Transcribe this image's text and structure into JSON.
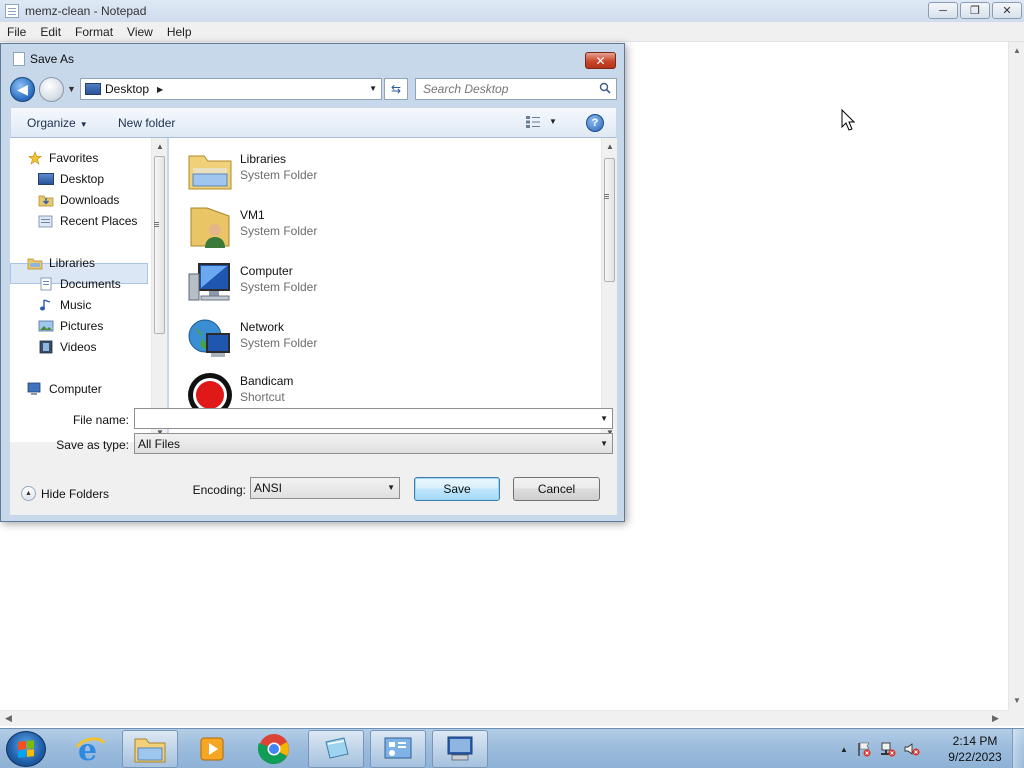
{
  "notepad": {
    "title": "memz-clean - Notepad",
    "menu": [
      "File",
      "Edit",
      "Format",
      "View",
      "Help"
    ],
    "window_buttons": {
      "minimize": "─",
      "restore": "❐",
      "close": "✕"
    }
  },
  "dialog": {
    "title": "Save As",
    "close_label": "✕",
    "address": {
      "location": "Desktop"
    },
    "search": {
      "placeholder": "Search Desktop"
    },
    "toolbar": {
      "organize": "Organize",
      "new_folder": "New folder",
      "help": "?"
    },
    "nav_pane": {
      "favorites_header": "Favorites",
      "favorites": [
        "Desktop",
        "Downloads",
        "Recent Places"
      ],
      "libraries_header": "Libraries",
      "libraries": [
        "Documents",
        "Music",
        "Pictures",
        "Videos"
      ],
      "computer": "Computer",
      "selected": "Desktop"
    },
    "files": [
      {
        "name": "Libraries",
        "type": "System Folder",
        "icon": "libraries-folder-icon"
      },
      {
        "name": "VM1",
        "type": "System Folder",
        "icon": "user-folder-icon"
      },
      {
        "name": "Computer",
        "type": "System Folder",
        "icon": "computer-icon"
      },
      {
        "name": "Network",
        "type": "System Folder",
        "icon": "network-icon"
      },
      {
        "name": "Bandicam",
        "type": "Shortcut",
        "icon": "bandicam-icon"
      }
    ],
    "file_name": {
      "label": "File name:",
      "value": ""
    },
    "save_as_type": {
      "label": "Save as type:",
      "value": "All Files"
    },
    "encoding": {
      "label": "Encoding:",
      "value": "ANSI"
    },
    "hide_folders": "Hide Folders",
    "save_button": "Save",
    "cancel_button": "Cancel"
  },
  "taskbar": {
    "clock_time": "2:14 PM",
    "clock_date": "9/22/2023",
    "pinned": [
      "internet-explorer-icon",
      "windows-explorer-icon",
      "media-player-icon",
      "chrome-icon",
      "notepad-icon",
      "control-panel-icon",
      "remote-desktop-icon"
    ]
  },
  "colors": {
    "accent": "#2c6fc4",
    "close_red": "#c8462a",
    "selection": "#dce7f5"
  }
}
